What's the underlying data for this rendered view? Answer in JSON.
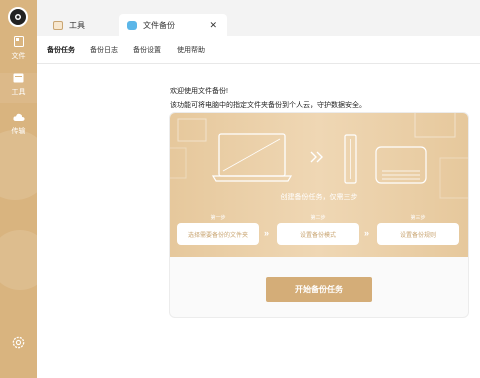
{
  "sidebar": {
    "items": [
      {
        "label": "文件",
        "icon": "file-icon"
      },
      {
        "label": "工具",
        "icon": "toolbox-icon"
      },
      {
        "label": "传输",
        "icon": "cloud-transfer-icon"
      }
    ],
    "active_index": 1,
    "settings_icon": "gear-icon",
    "color": "#d9b47f"
  },
  "tabs": [
    {
      "label": "工具",
      "icon": "window-icon"
    },
    {
      "label": "文件备份",
      "icon": "backup-app-icon",
      "close": "✕"
    }
  ],
  "subnav": {
    "items": [
      "备份任务",
      "备份日志",
      "备份设置",
      "使用帮助"
    ],
    "active_index": 0
  },
  "intro": {
    "line1": "欢迎使用文件备份!",
    "line2": "该功能可将电脑中的指定文件夹备份到个人云，守护数据安全。"
  },
  "banner": {
    "title": "创建备份任务，仅需三步",
    "arrow": "»",
    "steps": [
      {
        "step_label": "第一步",
        "button": "选择需要备份的文件夹"
      },
      {
        "step_label": "第二步",
        "button": "设置备份模式"
      },
      {
        "step_label": "第三步",
        "button": "设置备份规则"
      }
    ]
  },
  "start_button": "开始备份任务",
  "colors": {
    "accent": "#d4ad78",
    "banner": "#e6c89c"
  }
}
